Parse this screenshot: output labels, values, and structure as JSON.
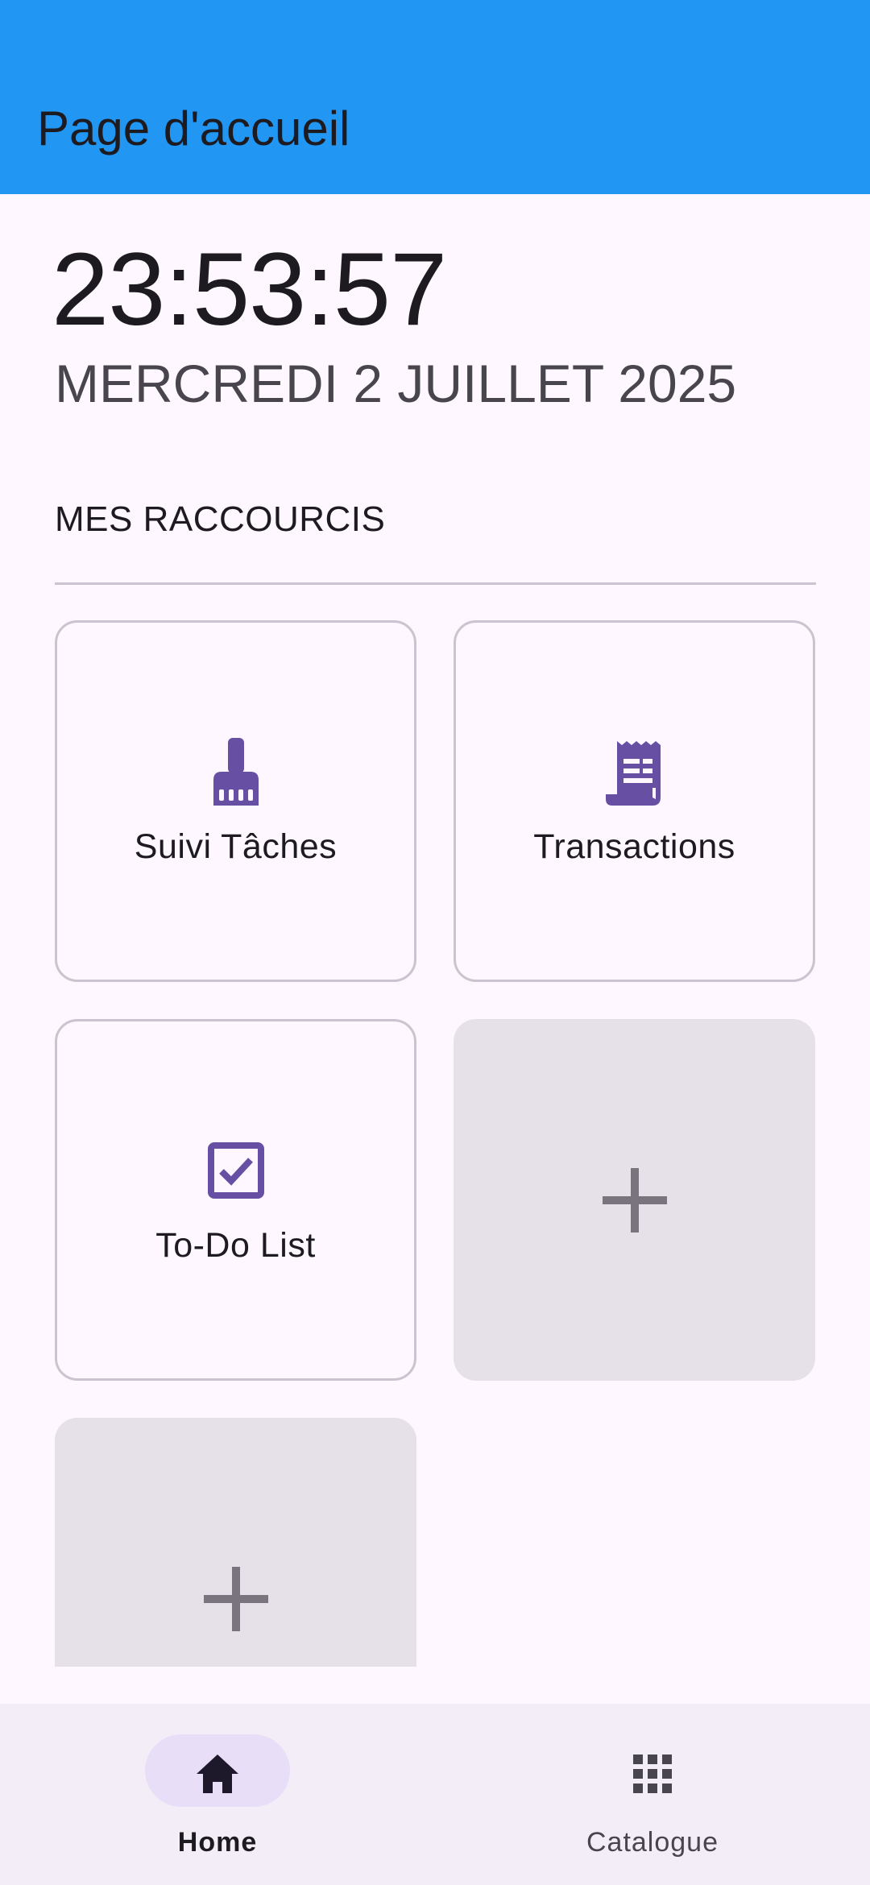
{
  "app_bar": {
    "title": "Page d'accueil",
    "color": "#2196F3"
  },
  "clock": {
    "time": "23:53:57",
    "date": "MERCREDI 2 JUILLET 2025"
  },
  "shortcuts": {
    "section_title": "MES RACCOURCIS",
    "tiles": [
      {
        "label": "Suivi Tâches",
        "icon": "broom-icon"
      },
      {
        "label": "Transactions",
        "icon": "receipt-icon"
      },
      {
        "label": "To-Do List",
        "icon": "checkbox-icon"
      },
      {
        "label": "",
        "icon": "plus-icon",
        "type": "add"
      },
      {
        "label": "",
        "icon": "plus-icon",
        "type": "add"
      }
    ],
    "icon_color": "#6750A4"
  },
  "bottom_nav": {
    "items": [
      {
        "label": "Home",
        "icon": "home-icon",
        "active": true
      },
      {
        "label": "Catalogue",
        "icon": "grid-icon",
        "active": false
      }
    ]
  }
}
